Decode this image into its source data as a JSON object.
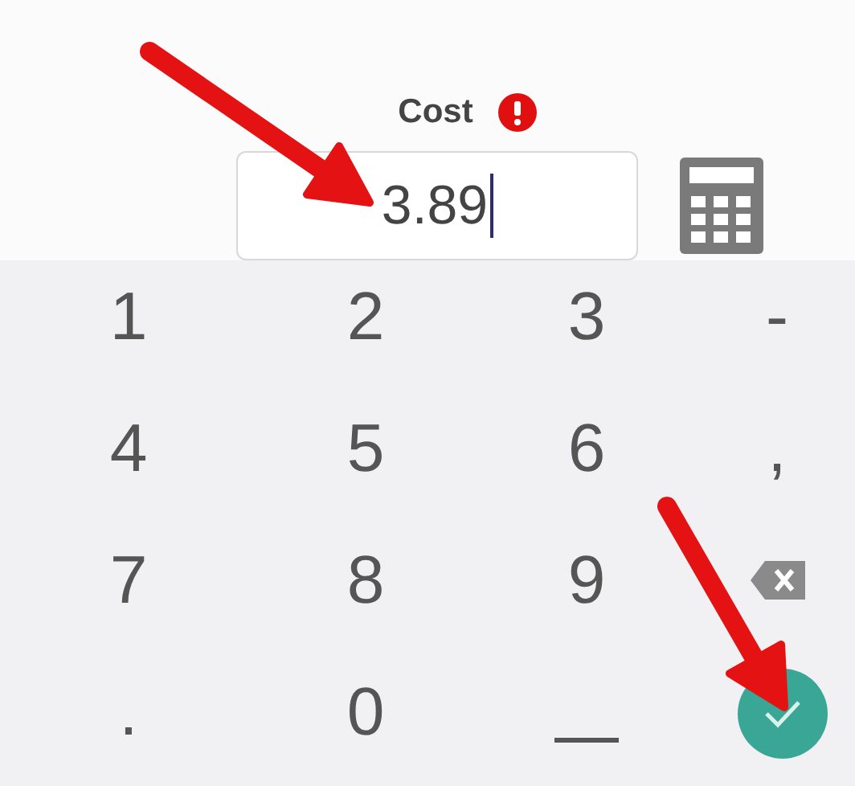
{
  "field": {
    "label": "Cost",
    "error": true,
    "value": "3.89",
    "focused": true
  },
  "keypad": [
    {
      "kind": "char",
      "label": "1"
    },
    {
      "kind": "char",
      "label": "2"
    },
    {
      "kind": "char",
      "label": "3"
    },
    {
      "kind": "char",
      "label": "-"
    },
    {
      "kind": "char",
      "label": "4"
    },
    {
      "kind": "char",
      "label": "5"
    },
    {
      "kind": "char",
      "label": "6"
    },
    {
      "kind": "char",
      "label": ","
    },
    {
      "kind": "char",
      "label": "7"
    },
    {
      "kind": "char",
      "label": "8"
    },
    {
      "kind": "char",
      "label": "9"
    },
    {
      "kind": "backspace"
    },
    {
      "kind": "char",
      "label": "."
    },
    {
      "kind": "char",
      "label": "0"
    },
    {
      "kind": "space"
    },
    {
      "kind": "done"
    }
  ]
}
